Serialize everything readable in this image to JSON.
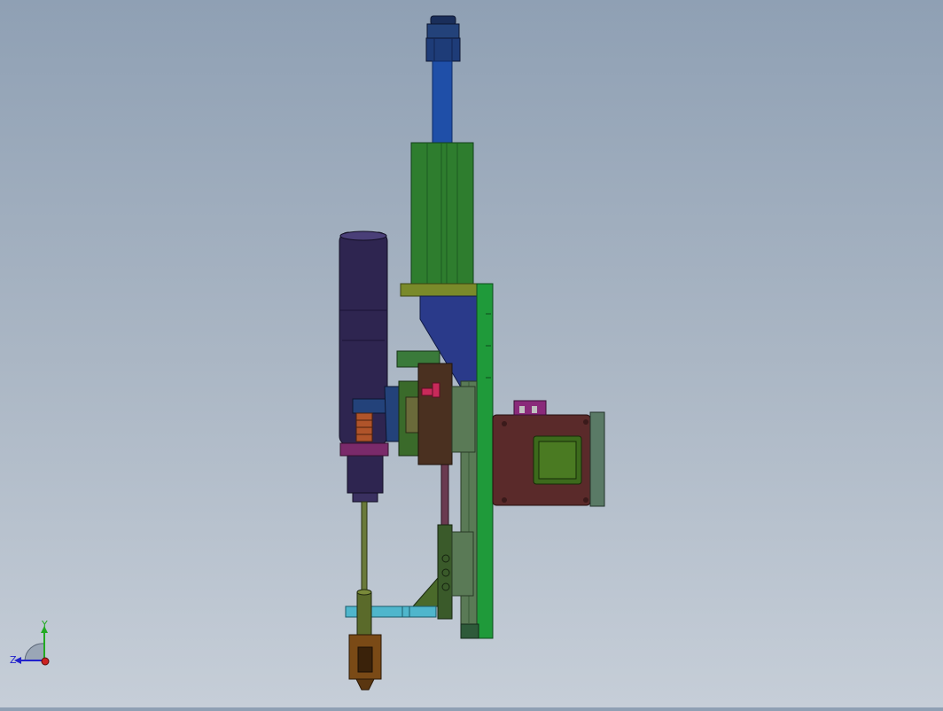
{
  "viewport": {
    "background_top": "#8fa0b4",
    "background_bottom": "#c6ced8"
  },
  "model": {
    "parts": [
      "top-cylinder-cap",
      "piston-rod",
      "linear-actuator-body",
      "mounting-plate",
      "drive-motor",
      "gear-coupling",
      "spindle-shaft",
      "clamp-jaw",
      "slide-rail",
      "stepper-motor",
      "stepper-face-plate",
      "tool-holder-bracket",
      "nozzle-tip"
    ],
    "colors": {
      "actuator_body": "#2e7d2e",
      "cylinder": "#1f4fa8",
      "motor": "#2e2550",
      "plate": "#1f9a3a",
      "stepper": "#5a2a2a",
      "stepper_face": "#3c6a1c",
      "bracket": "#4fb6cc",
      "nozzle": "#7a4a16",
      "accent_magenta": "#a0206a",
      "wedge": "#2a3a8a"
    }
  },
  "triad": {
    "x_label": "",
    "y_label": "Y",
    "z_label": "Z",
    "y_color": "#22aa22",
    "z_color": "#2222cc",
    "x_color": "#cc2222"
  }
}
